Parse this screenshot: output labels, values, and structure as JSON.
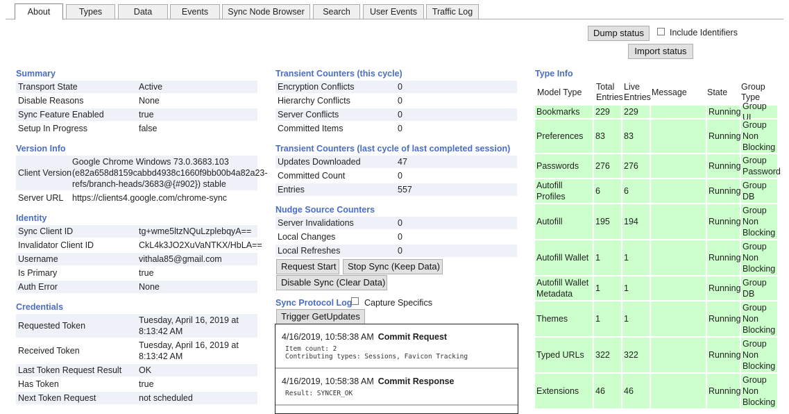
{
  "tabs": [
    "About",
    "Types",
    "Data",
    "Events",
    "Sync Node Browser",
    "Search",
    "User Events",
    "Traffic Log"
  ],
  "controls": {
    "dump_status": "Dump status",
    "include_identifiers": "Include Identifiers",
    "import_status": "Import status"
  },
  "summary": {
    "title": "Summary",
    "rows": [
      [
        "Transport State",
        "Active"
      ],
      [
        "Disable Reasons",
        "None"
      ],
      [
        "Sync Feature Enabled",
        "true"
      ],
      [
        "Setup In Progress",
        "false"
      ]
    ]
  },
  "version_info": {
    "title": "Version Info",
    "client_version_label": "Client Version",
    "client_version_value": "Google Chrome Windows 73.0.3683.103 (e82a658d8159cabbd4938c1660f9bb00b4a82a23-refs/branch-heads/3683@{#902}) stable",
    "server_url_label": "Server URL",
    "server_url_value": "https://clients4.google.com/chrome-sync"
  },
  "identity": {
    "title": "Identity",
    "rows": [
      [
        "Sync Client ID",
        "tg+wme5ltzNQuLzplebqyA=="
      ],
      [
        "Invalidator Client ID",
        "CkL4k3JO2XuVaNTKX/HbLA=="
      ],
      [
        "Username",
        "vithala85@gmail.com"
      ],
      [
        "Is Primary",
        "true"
      ],
      [
        "Auth Error",
        "None"
      ]
    ]
  },
  "credentials": {
    "title": "Credentials",
    "requested_token_label": "Requested Token",
    "requested_token_value": "Tuesday, April 16, 2019 at 8:13:42 AM",
    "received_token_label": "Received Token",
    "received_token_value": "Tuesday, April 16, 2019 at 8:13:42 AM",
    "rows": [
      [
        "Last Token Request Result",
        "OK"
      ],
      [
        "Has Token",
        "true"
      ],
      [
        "Next Token Request",
        "not scheduled"
      ]
    ]
  },
  "transient": {
    "title": "Transient Counters (this cycle)",
    "rows": [
      [
        "Encryption Conflicts",
        "0"
      ],
      [
        "Hierarchy Conflicts",
        "0"
      ],
      [
        "Server Conflicts",
        "0"
      ],
      [
        "Committed Items",
        "0"
      ]
    ]
  },
  "transient_last": {
    "title": "Transient Counters (last cycle of last completed session)",
    "rows": [
      [
        "Updates Downloaded",
        "47"
      ],
      [
        "Committed Count",
        "0"
      ],
      [
        "Entries",
        "557"
      ]
    ]
  },
  "nudge": {
    "title": "Nudge Source Counters",
    "rows": [
      [
        "Server Invalidations",
        "0"
      ],
      [
        "Local Changes",
        "0"
      ],
      [
        "Local Refreshes",
        "0"
      ]
    ]
  },
  "actions": {
    "request_start": "Request Start",
    "stop_sync": "Stop Sync (Keep Data)",
    "disable_sync": "Disable Sync (Clear Data)"
  },
  "protocol_log": {
    "title": "Sync Protocol Log",
    "capture_specifics": "Capture Specifics",
    "trigger": "Trigger GetUpdates",
    "entries": [
      {
        "time": "4/16/2019, 10:58:38 AM",
        "title": "Commit Request",
        "details": [
          "Item count: 2",
          "Contributing types: Sessions, Favicon Tracking"
        ]
      },
      {
        "time": "4/16/2019, 10:58:38 AM",
        "title": "Commit Response",
        "details": [
          "Result: SYNCER_OK"
        ]
      }
    ]
  },
  "type_info": {
    "title": "Type Info",
    "headers": [
      "Model Type",
      "Total Entries",
      "Live Entries",
      "Message",
      "State",
      "Group Type"
    ],
    "rows": [
      [
        "Bookmarks",
        "229",
        "229",
        "",
        "Running",
        "Group UI"
      ],
      [
        "Preferences",
        "83",
        "83",
        "",
        "Running",
        "Group Non Blocking"
      ],
      [
        "Passwords",
        "276",
        "276",
        "",
        "Running",
        "Group Password"
      ],
      [
        "Autofill Profiles",
        "6",
        "6",
        "",
        "Running",
        "Group DB"
      ],
      [
        "Autofill",
        "195",
        "194",
        "",
        "Running",
        "Group Non Blocking"
      ],
      [
        "Autofill Wallet",
        "1",
        "1",
        "",
        "Running",
        "Group Non Blocking"
      ],
      [
        "Autofill Wallet Metadata",
        "1",
        "1",
        "",
        "Running",
        "Group DB"
      ],
      [
        "Themes",
        "1",
        "1",
        "",
        "Running",
        "Group Non Blocking"
      ],
      [
        "Typed URLs",
        "322",
        "322",
        "",
        "Running",
        "Group Non Blocking"
      ],
      [
        "Extensions",
        "46",
        "46",
        "",
        "Running",
        "Group Non Blocking"
      ]
    ]
  },
  "colors": {
    "section_title": "#4a6dc4",
    "row_shade": "#eef2f8",
    "type_row": "#ccffcc"
  }
}
